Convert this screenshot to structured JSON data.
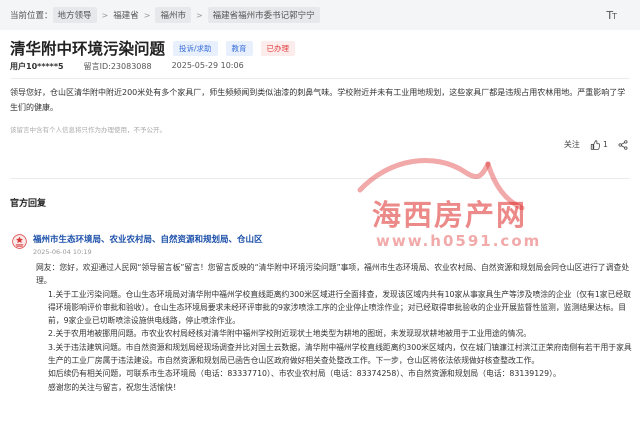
{
  "breadcrumb": {
    "prefix": "当前位置：",
    "items": [
      "地方领导",
      "福建省",
      "福州市",
      "福建省福州市委书记郭宁宁"
    ]
  },
  "post": {
    "title": "清华附中环境污染问题",
    "tags": [
      "投诉/求助",
      "教育",
      "已办理"
    ],
    "user": "用户10*****5",
    "message_id": "留言ID:23083088",
    "time": "2025-05-29 10:06",
    "message": "领导您好，仓山区清华附中附近200米处有多个家具厂，师生频频闻到类似油漆的刺鼻气味。学校附近并未有工业用地规划，这些家具厂都是违规占用农林用地。严重影响了学生们的健康。",
    "note": "该留言中含有个人信息将只作为办理使用，不予公开。"
  },
  "actions": {
    "follow": "关注",
    "like_count": "1"
  },
  "reply": {
    "section_title": "官方回复",
    "org": "福州市生态环境局、农业农村局、自然资源和规划局、仓山区",
    "time": "2025-06-04 10:19",
    "paragraphs": [
      "网友：您好，欢迎通过人民网“领导留言板”留言！您留言反映的“清华附中环境污染问题”事项，福州市生态环境局、农业农村局、自然资源和规划局会同仓山区进行了调查处理。",
      "1.关于工业污染问题。仓山生态环境局对清华附中福州学校直线距离约300米区域进行全面排查，发现该区域内共有10家从事家具生产等涉及喷涂的企业（仅有1家已经取得环境影响评价审批和验收）。仓山生态环境局要求未经环评审批的9家涉喷涂工序的企业停止喷涂作业；对已经取得审批验收的企业开展监督性监测，监测结果达标。目前，9家企业已切断喷涂设施供电线路，停止喷涂作业。",
      "2.关于农用地被挪用问题。市农业农村局经核对清华附中福州学校附近现状土地类型为耕地的图斑，未发现现状耕地被用于工业用途的情况。",
      "3.关于违法建筑问题。市自然资源和规划局经现场调查并比对国土云数据，清华附中福州学校直线距离约300米区域内，仅在城门镇濂江村滨江正荣府南侧有若干用于家具生产的工业厂房属于违法建设。市自然资源和规划局已函告仓山区政府做好相关查处整改工作。下一步，仓山区将依法依规做好核查整改工作。",
      "如后续仍有相关问题，可联系市生态环境局（电话：83337710）、市农业农村局（电话：83374258）、市自然资源和规划局（电话：83139129）。",
      "感谢您的关注与留言，祝您生活愉快！"
    ]
  },
  "watermark": {
    "title": "海西房产网",
    "url": "www.h0591.com"
  },
  "icons": {
    "font_size": "font-size-icon",
    "like": "thumb-up-icon",
    "share": "share-icon",
    "org": "government-emblem-icon"
  },
  "colors": {
    "tag_blue": "#3a6fd8",
    "tag_red": "#e23b3b",
    "org_name": "#1a4ea8",
    "watermark": "#dc2828"
  }
}
